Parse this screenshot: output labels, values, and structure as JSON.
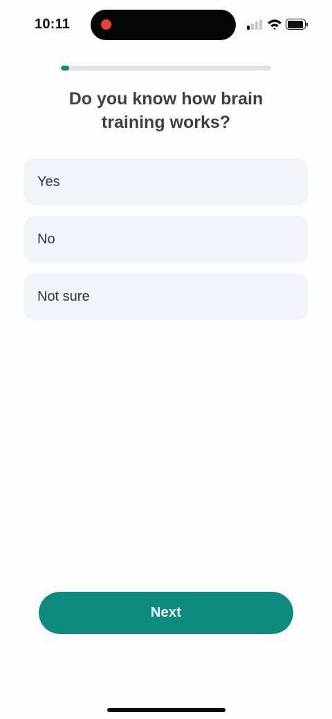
{
  "status_bar": {
    "time": "10:11",
    "recording_color": "#e8432f",
    "signal_bars_active": 1,
    "signal_bars_total": 4
  },
  "progress": {
    "fraction": 0.04,
    "fill_color": "#0c8b7e",
    "track_color": "#dfe3ec"
  },
  "question": {
    "title": "Do you know how brain training works?"
  },
  "options": [
    {
      "label": "Yes"
    },
    {
      "label": "No"
    },
    {
      "label": "Not sure"
    }
  ],
  "footer": {
    "next_label": "Next",
    "accent_color": "#0c8b7e"
  }
}
